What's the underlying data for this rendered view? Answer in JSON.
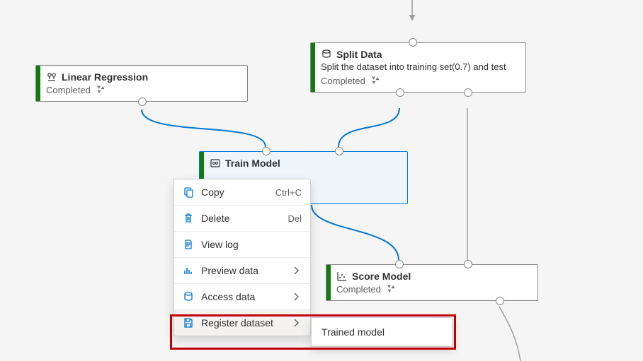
{
  "nodes": {
    "linear_regression": {
      "title": "Linear Regression",
      "status": "Completed"
    },
    "split_data": {
      "title": "Split Data",
      "desc": "Split the dataset into training set(0.7) and test",
      "status": "Completed"
    },
    "train_model": {
      "title": "Train Model"
    },
    "score_model": {
      "title": "Score Model",
      "status": "Completed"
    }
  },
  "menu": {
    "copy": {
      "label": "Copy",
      "shortcut": "Ctrl+C"
    },
    "delete": {
      "label": "Delete",
      "shortcut": "Del"
    },
    "view_log": {
      "label": "View log"
    },
    "preview_data": {
      "label": "Preview data"
    },
    "access_data": {
      "label": "Access data"
    },
    "register_dataset": {
      "label": "Register dataset"
    }
  },
  "submenu": {
    "trained_model": "Trained model"
  },
  "colors": {
    "accent": "#107c10",
    "selected": "#0078d4",
    "highlight": "#c00000",
    "icon_blue": "#0078d4"
  }
}
